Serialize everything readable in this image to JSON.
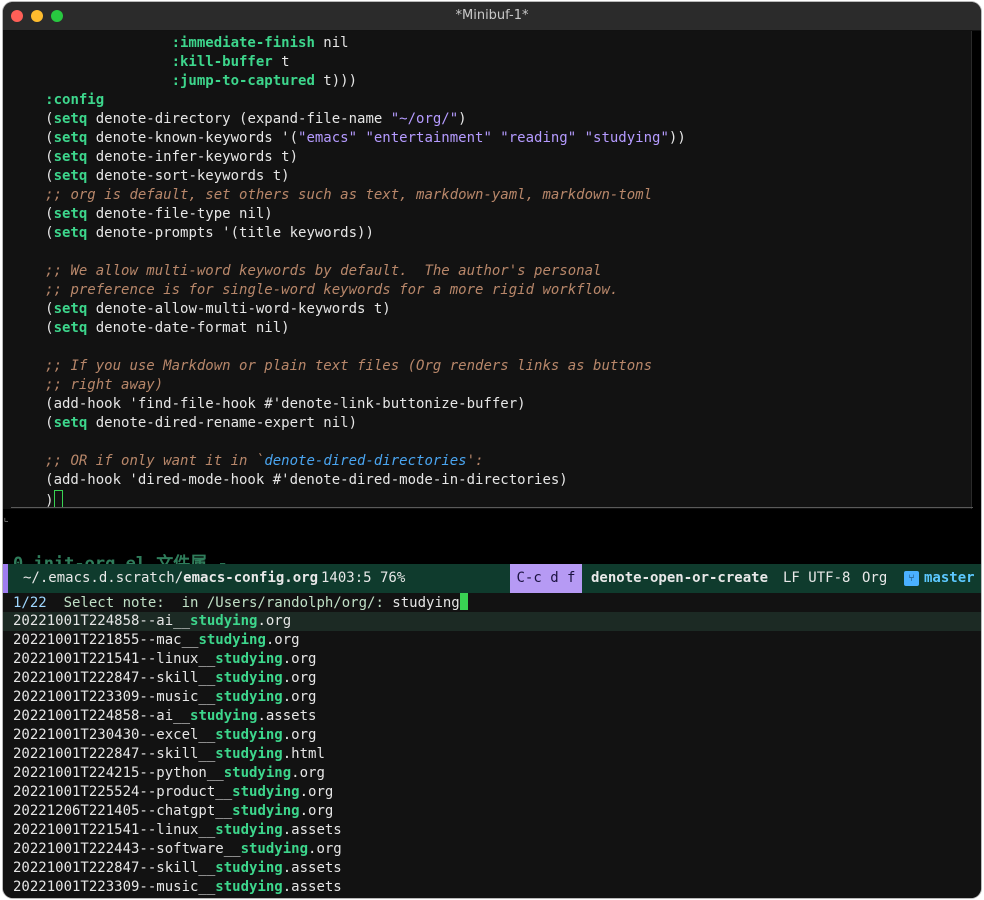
{
  "window": {
    "title": "*Minibuf-1*"
  },
  "editor": {
    "lines": [
      [
        {
          "t": "                    "
        },
        {
          "t": ":immediate-finish",
          "c": "k"
        },
        {
          "t": " nil"
        }
      ],
      [
        {
          "t": "                    "
        },
        {
          "t": ":kill-buffer",
          "c": "k"
        },
        {
          "t": " t"
        }
      ],
      [
        {
          "t": "                    "
        },
        {
          "t": ":jump-to-captured",
          "c": "k"
        },
        {
          "t": " t)))"
        }
      ],
      [
        {
          "t": "     "
        },
        {
          "t": ":config",
          "c": "k"
        }
      ],
      [
        {
          "t": "     ("
        },
        {
          "t": "setq",
          "c": "k"
        },
        {
          "t": " denote-directory (expand-file-name "
        },
        {
          "t": "\"~/org/\"",
          "c": "s"
        },
        {
          "t": ")"
        }
      ],
      [
        {
          "t": "     ("
        },
        {
          "t": "setq",
          "c": "k"
        },
        {
          "t": " denote-known-keywords '("
        },
        {
          "t": "\"emacs\" \"entertainment\" \"reading\" \"studying\"",
          "c": "s"
        },
        {
          "t": "))"
        }
      ],
      [
        {
          "t": "     ("
        },
        {
          "t": "setq",
          "c": "k"
        },
        {
          "t": " denote-infer-keywords t)"
        }
      ],
      [
        {
          "t": "     ("
        },
        {
          "t": "setq",
          "c": "k"
        },
        {
          "t": " denote-sort-keywords t)"
        }
      ],
      [
        {
          "t": "     "
        },
        {
          "t": ";; org is default, set others such as text, markdown-yaml, markdown-toml",
          "c": "c"
        }
      ],
      [
        {
          "t": "     ("
        },
        {
          "t": "setq",
          "c": "k"
        },
        {
          "t": " denote-file-type nil)"
        }
      ],
      [
        {
          "t": "     ("
        },
        {
          "t": "setq",
          "c": "k"
        },
        {
          "t": " denote-prompts '(title keywords))"
        }
      ],
      [
        {
          "t": ""
        }
      ],
      [
        {
          "t": "     "
        },
        {
          "t": ";; We allow multi-word keywords by default.  The author's personal",
          "c": "c"
        }
      ],
      [
        {
          "t": "     "
        },
        {
          "t": ";; preference is for single-word keywords for a more rigid workflow.",
          "c": "c"
        }
      ],
      [
        {
          "t": "     ("
        },
        {
          "t": "setq",
          "c": "k"
        },
        {
          "t": " denote-allow-multi-word-keywords t)"
        }
      ],
      [
        {
          "t": "     ("
        },
        {
          "t": "setq",
          "c": "k"
        },
        {
          "t": " denote-date-format nil)"
        }
      ],
      [
        {
          "t": ""
        }
      ],
      [
        {
          "t": "     "
        },
        {
          "t": ";; If you use Markdown or plain text files (Org renders links as buttons",
          "c": "c"
        }
      ],
      [
        {
          "t": "     "
        },
        {
          "t": ";; right away)",
          "c": "c"
        }
      ],
      [
        {
          "t": "     (add-hook 'find-file-hook #'denote-link-buttonize-buffer)"
        }
      ],
      [
        {
          "t": "     ("
        },
        {
          "t": "setq",
          "c": "k"
        },
        {
          "t": " denote-dired-rename-expert nil)"
        }
      ],
      [
        {
          "t": ""
        }
      ],
      [
        {
          "t": "     "
        },
        {
          "t": ";; OR if only want it in `",
          "c": "c"
        },
        {
          "t": "denote-dired-directories",
          "c": "cl"
        },
        {
          "t": "':",
          "c": "c"
        }
      ],
      [
        {
          "t": "     (add-hook 'dired-mode-hook #'denote-dired-mode-in-directories)"
        }
      ],
      [
        {
          "t": "     )"
        },
        {
          "t": "",
          "c": "cursor"
        }
      ]
    ],
    "hidden_line": "0 init-org.el  文件属 -"
  },
  "modeline": {
    "file": "~/.emacs.d.scratch/",
    "file_bold": "emacs-config.org",
    "position": "1403:5 76%",
    "keys": "C-c d f",
    "command": "denote-open-or-create",
    "encoding": "LF UTF-8",
    "mode": "Org",
    "vcs_icon": "branch-icon",
    "branch": "master"
  },
  "minibuffer": {
    "count": "1/22",
    "label": "  Select note:  in /Users/randolph/org/: ",
    "input": "studying",
    "candidates": [
      {
        "pre": "20221001T224858--ai__",
        "match": "studying",
        "post": ".org",
        "selected": true
      },
      {
        "pre": "20221001T221855--mac__",
        "match": "studying",
        "post": ".org"
      },
      {
        "pre": "20221001T221541--linux__",
        "match": "studying",
        "post": ".org"
      },
      {
        "pre": "20221001T222847--skill__",
        "match": "studying",
        "post": ".org"
      },
      {
        "pre": "20221001T223309--music__",
        "match": "studying",
        "post": ".org"
      },
      {
        "pre": "20221001T224858--ai__",
        "match": "studying",
        "post": ".assets"
      },
      {
        "pre": "20221001T230430--excel__",
        "match": "studying",
        "post": ".org"
      },
      {
        "pre": "20221001T222847--skill__",
        "match": "studying",
        "post": ".html"
      },
      {
        "pre": "20221001T224215--python__",
        "match": "studying",
        "post": ".org"
      },
      {
        "pre": "20221001T225524--product__",
        "match": "studying",
        "post": ".org"
      },
      {
        "pre": "20221206T221405--chatgpt__",
        "match": "studying",
        "post": ".org"
      },
      {
        "pre": "20221001T221541--linux__",
        "match": "studying",
        "post": ".assets"
      },
      {
        "pre": "20221001T222443--software__",
        "match": "studying",
        "post": ".org"
      },
      {
        "pre": "20221001T222847--skill__",
        "match": "studying",
        "post": ".assets"
      },
      {
        "pre": "20221001T223309--music__",
        "match": "studying",
        "post": ".assets"
      }
    ]
  }
}
